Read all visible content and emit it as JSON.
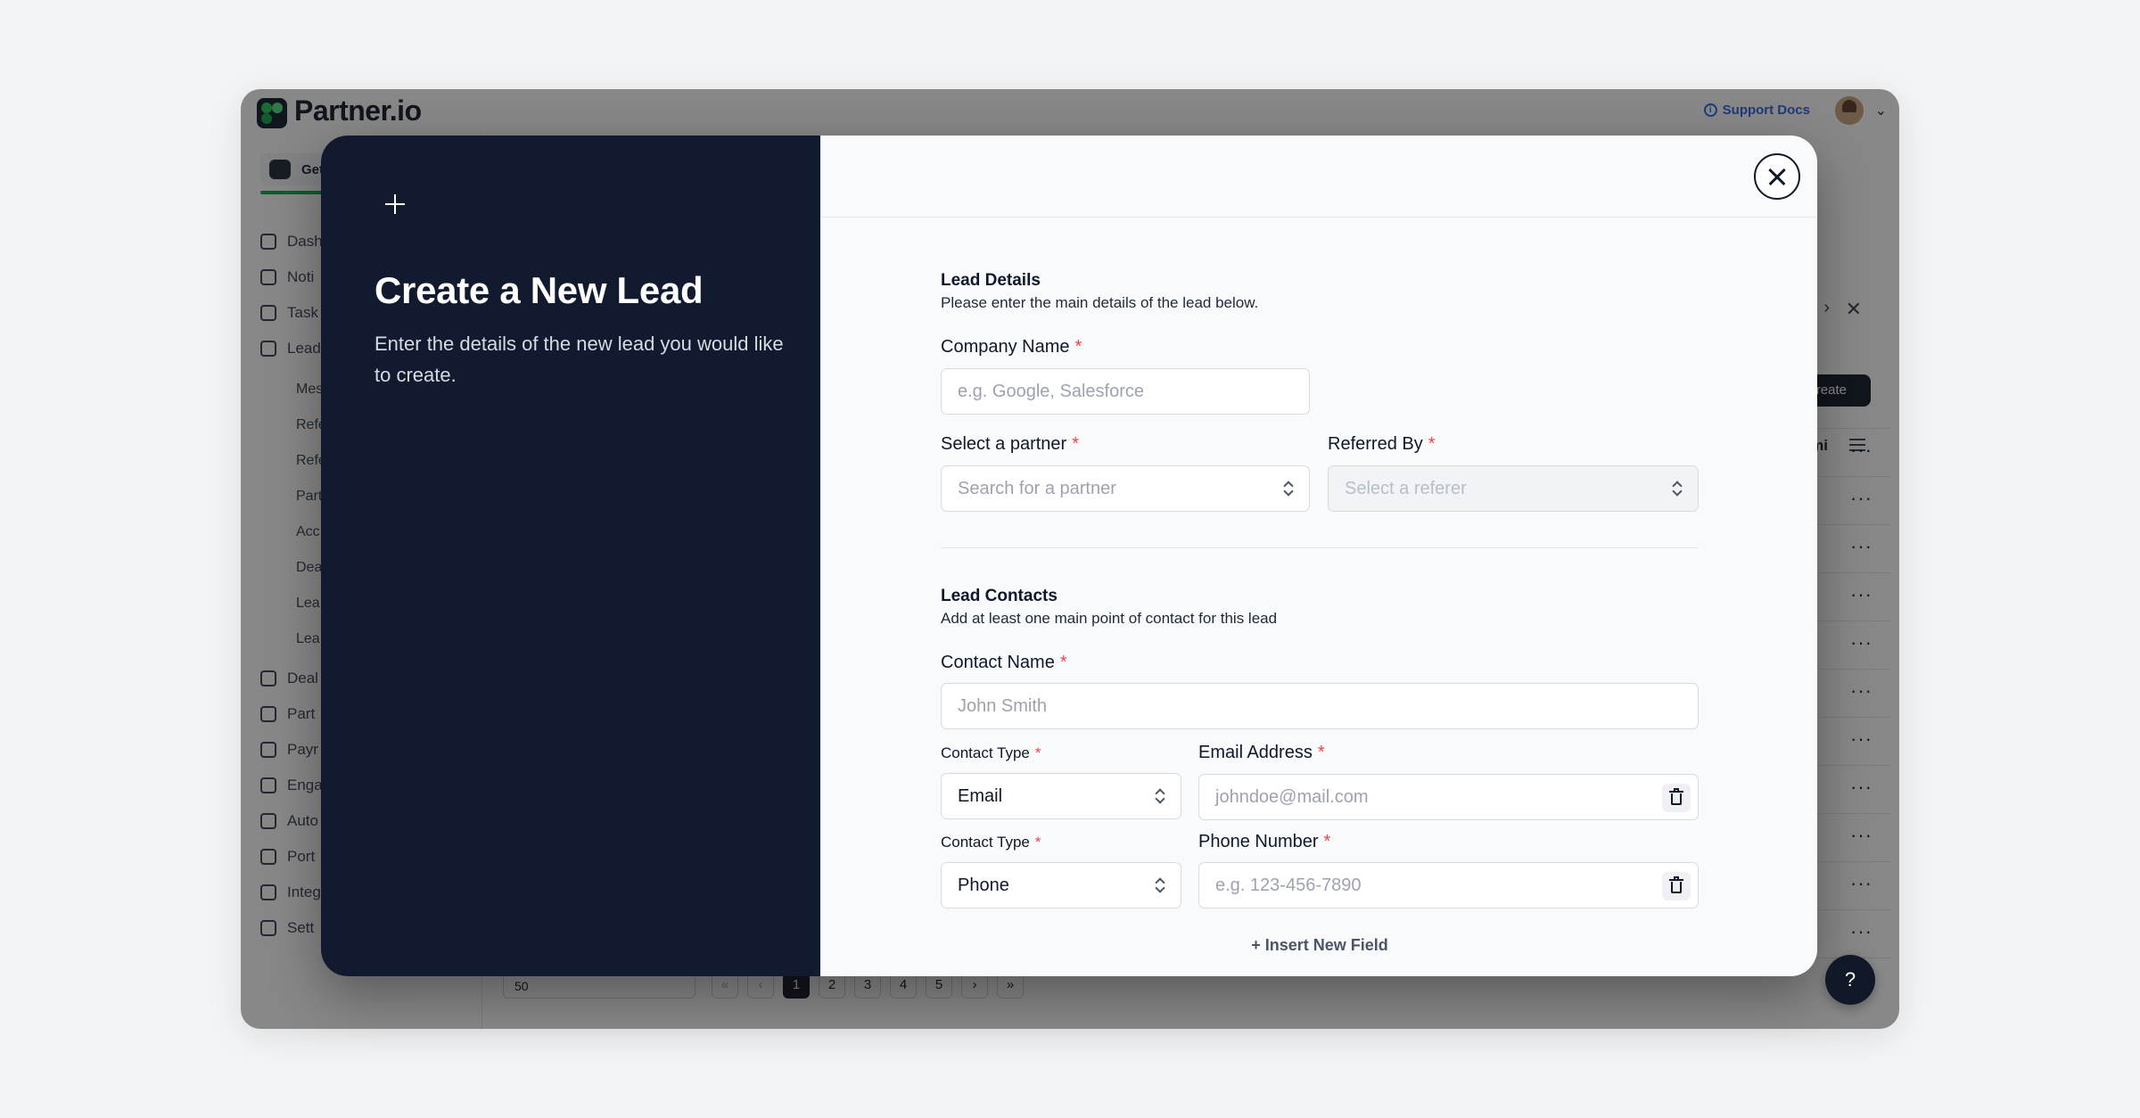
{
  "app": {
    "logo_text": "Partner.io",
    "support_label": "Support Docs",
    "get_started_label": "Get",
    "sidebar_items": [
      "Dash",
      "Noti",
      "Task",
      "Lead",
      "Deal",
      "Part",
      "Payr",
      "Enga",
      "Auto",
      "Port",
      "Integ",
      "Sett"
    ],
    "sidebar_sub_items": [
      "Mes",
      "Refe",
      "Refe",
      "Part",
      "Acc",
      "Dea",
      "Lea",
      "Lea"
    ],
    "create_label": "Create",
    "column_label": "mi",
    "row_action_label": "···",
    "pagination": {
      "per_page": "50",
      "first": "«",
      "prev": "‹",
      "pages": [
        "1",
        "2",
        "3",
        "4",
        "5"
      ],
      "next": "›",
      "last": "»"
    },
    "help_label": "?"
  },
  "modal": {
    "title": "Create a New Lead",
    "description": "Enter the details of the new lead you would like to create.",
    "lead_details": {
      "title": "Lead Details",
      "subtitle": "Please enter the main details of the lead below.",
      "company_name_label": "Company Name",
      "company_name_placeholder": "e.g. Google, Salesforce",
      "partner_label": "Select a partner",
      "partner_placeholder": "Search for a partner",
      "referred_by_label": "Referred By",
      "referred_by_placeholder": "Select a referer"
    },
    "lead_contacts": {
      "title": "Lead Contacts",
      "subtitle": "Add at least one main point of contact for this lead",
      "contact_name_label": "Contact Name",
      "contact_name_placeholder": "John Smith",
      "contact_type_label": "Contact Type",
      "email_type_value": "Email",
      "email_label": "Email Address",
      "email_placeholder": "johndoe@mail.com",
      "phone_type_value": "Phone",
      "phone_label": "Phone Number",
      "phone_placeholder": "e.g. 123-456-7890",
      "insert_field_label": "+ Insert New Field"
    },
    "required_mark": "*"
  },
  "colors": {
    "modal_left_bg": "#111a2e",
    "accent_green": "#16a34a",
    "required_red": "#ef4444",
    "link_blue": "#2563eb"
  }
}
